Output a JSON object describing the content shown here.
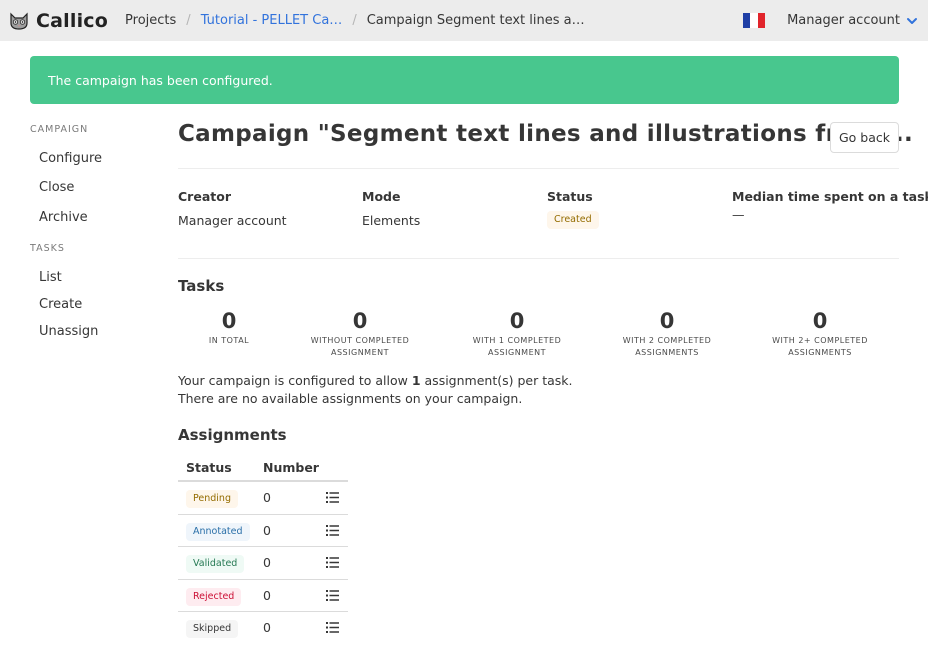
{
  "nav": {
    "brand": "Callico",
    "breadcrumb": [
      "Projects",
      "Tutorial - PELLET Ca…",
      "Campaign Segment text lines a…"
    ],
    "user": "Manager account"
  },
  "notification": "The campaign has been configured.",
  "sidebar": {
    "campaign_label": "CAMPAIGN",
    "campaign_items": [
      "Configure",
      "Close",
      "Archive"
    ],
    "tasks_label": "TASKS",
    "tasks_items": [
      "List",
      "Create",
      "Unassign"
    ]
  },
  "page": {
    "title": "Campaign \"Segment text lines and illustrations from ...",
    "go_back": "Go back"
  },
  "info": {
    "creator_label": "Creator",
    "creator": "Manager account",
    "mode_label": "Mode",
    "mode": "Elements",
    "status_label": "Status",
    "status": "Created",
    "median_label": "Median time spent on a task",
    "median": "—"
  },
  "tasks": {
    "heading": "Tasks",
    "stats": [
      {
        "value": "0",
        "label": "IN TOTAL"
      },
      {
        "value": "0",
        "label": "WITHOUT COMPLETED ASSIGNMENT"
      },
      {
        "value": "0",
        "label": "WITH 1 COMPLETED ASSIGNMENT"
      },
      {
        "value": "0",
        "label": "WITH 2 COMPLETED ASSIGNMENTS"
      },
      {
        "value": "0",
        "label": "WITH 2+ COMPLETED ASSIGNMENTS"
      }
    ],
    "config_prefix": "Your campaign is configured to allow ",
    "config_count": "1",
    "config_suffix": " assignment(s) per task.",
    "availability": "There are no available assignments on your campaign."
  },
  "assignments": {
    "heading": "Assignments",
    "col_status": "Status",
    "col_number": "Number",
    "rows": [
      {
        "status": "Pending",
        "number": "0"
      },
      {
        "status": "Annotated",
        "number": "0"
      },
      {
        "status": "Validated",
        "number": "0"
      },
      {
        "status": "Rejected",
        "number": "0"
      },
      {
        "status": "Skipped",
        "number": "0"
      }
    ]
  },
  "colors": {
    "success": "#48c78e",
    "link": "#3273dc",
    "pending_bg": "#fef6eb",
    "pending_fg": "#946c00",
    "annotated_bg": "#eff5fb",
    "annotated_fg": "#296fa8",
    "validated_bg": "#effaf5",
    "validated_fg": "#257953",
    "rejected_bg": "#feecf0",
    "rejected_fg": "#cc0f35",
    "skipped_bg": "#f5f5f5",
    "skipped_fg": "#363636"
  },
  "icons": {
    "brand": "cat-logo-icon",
    "flag": "french-flag-icon",
    "user_menu": "chevron-down-icon",
    "assignment_list": "list-icon"
  }
}
